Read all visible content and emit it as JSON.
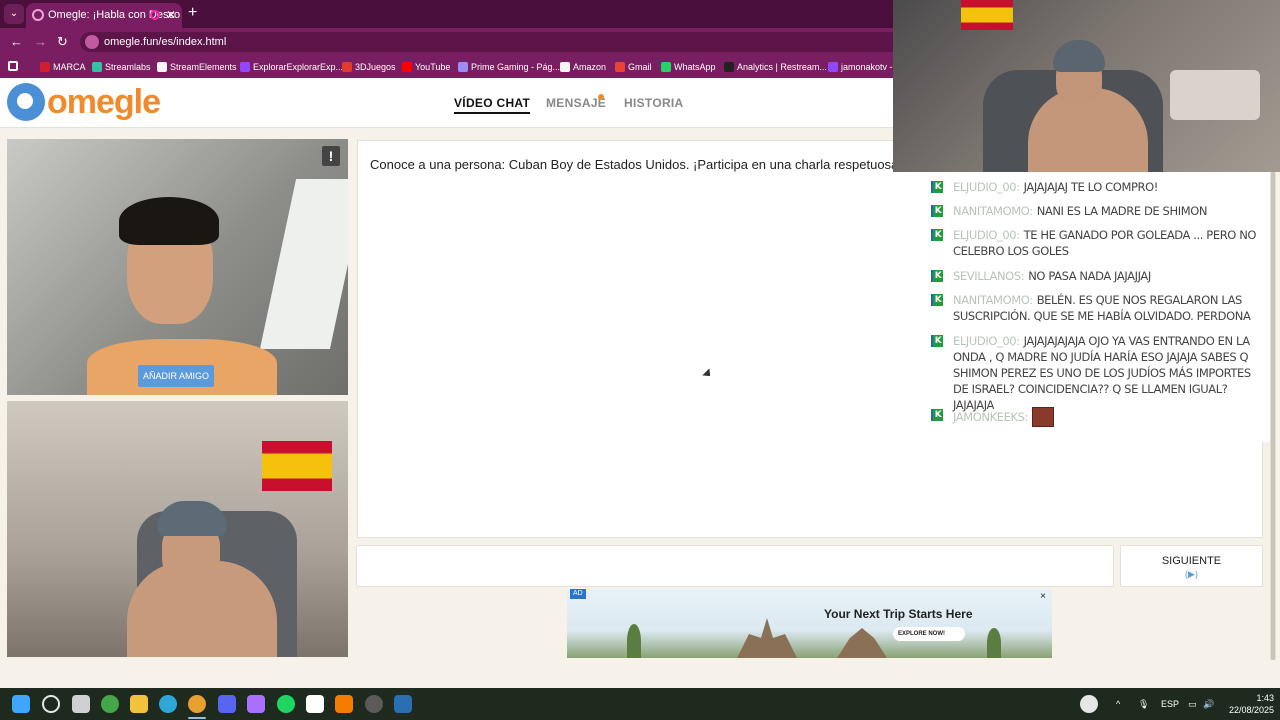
{
  "browser": {
    "tab_title": "Omegle: ¡Habla con Desco",
    "new_tab": "+",
    "url": "omegle.fun/es/index.html",
    "bookmarks": [
      {
        "label": "MARCA",
        "color": "#d11e2b"
      },
      {
        "label": "Streamlabs",
        "color": "#31c3a2"
      },
      {
        "label": "StreamElements",
        "color": "#f5f5f5"
      },
      {
        "label": "ExplorarExplorarExp...",
        "color": "#9146ff"
      },
      {
        "label": "3DJuegos",
        "color": "#e03a2f"
      },
      {
        "label": "YouTube",
        "color": "#ff0000"
      },
      {
        "label": "Prime Gaming - Pág...",
        "color": "#9c8cf5"
      },
      {
        "label": "Amazon",
        "color": "#f5f5f5"
      },
      {
        "label": "Gmail",
        "color": "#ea4335"
      },
      {
        "label": "WhatsApp",
        "color": "#25d366"
      },
      {
        "label": "Analytics | Restream...",
        "color": "#222"
      },
      {
        "label": "jamonakotv - T",
        "color": "#9146ff"
      }
    ]
  },
  "site": {
    "logo": "omegle",
    "nav": {
      "video_chat": "VÍDEO CHAT",
      "message": "MENSAJE",
      "history": "HISTORIA"
    }
  },
  "stranger_video": {
    "report_label": "!",
    "add_friend": "AÑADIR AMIGO"
  },
  "chat": {
    "intro": "Conoce a una persona: Cuban Boy de Estados Unidos. ¡Participa en una charla respetuosa!"
  },
  "controls": {
    "next_label": "SIGUIENTE",
    "next_icon": "(▶)"
  },
  "ad": {
    "badge": "AD",
    "title": "Your Next Trip Starts Here",
    "cta": "EXPLORE NOW!",
    "close": "×"
  },
  "stream_chat": {
    "messages": [
      {
        "user": "ElJudio_00:",
        "text": "JAJAJAJAJ TE LO COMPRO!"
      },
      {
        "user": "nanitamomo:",
        "text": "NANI ES LA MADRE DE SHIMON"
      },
      {
        "user": "ElJudio_00:",
        "text": "TE HE GANADO POR GOLEADA ... PERO NO CELEBRO LOS GOLES"
      },
      {
        "user": "Sevillanos:",
        "text": "NO PASA NADA JAJAJJAJ"
      },
      {
        "user": "nanitamomo:",
        "text": "BELÉN. ES QUE NOS REGALARON LAS SUSCRIPCIÓN. QUE SE ME HABÍA OLVIDADO. PERDONA"
      },
      {
        "user": "ElJudio_00:",
        "text": "JAJAJAJAJAJA OJO YA VAS ENTRANDO EN LA ONDA , Q MADRE NO JUDÍA HARÍA ESO JAJAJA SABES Q SHIMON PEREZ ES UNO DE LOS JUDÍOS MÁS IMPORTES DE ISRAEL? COINCIDENCIA?? Q SE LLAMEN IGUAL? JAJAJAJA"
      },
      {
        "user": "Jamonkeeks:",
        "text": ""
      }
    ]
  },
  "taskbar": {
    "apps": [
      {
        "name": "windows-start",
        "color": "#3ea6ff"
      },
      {
        "name": "search",
        "color": "#e6e6e6"
      },
      {
        "name": "task-view",
        "color": "#d0d0d0"
      },
      {
        "name": "xbox",
        "color": "#46a64a"
      },
      {
        "name": "file-explorer",
        "color": "#f3c23c"
      },
      {
        "name": "edge",
        "color": "#2fa6d8"
      },
      {
        "name": "chrome",
        "color": "#e5a031"
      },
      {
        "name": "discord",
        "color": "#5865f2"
      },
      {
        "name": "twitch-chat",
        "color": "#a970ff"
      },
      {
        "name": "spotify",
        "color": "#1ed760"
      },
      {
        "name": "capcut",
        "color": "#ffffff"
      },
      {
        "name": "fl-studio",
        "color": "#f57c00"
      },
      {
        "name": "obs",
        "color": "#5a5a5a"
      },
      {
        "name": "steam",
        "color": "#2a6fb0"
      }
    ],
    "language": "ESP",
    "time": "1:43",
    "date": "22/08/2025"
  }
}
